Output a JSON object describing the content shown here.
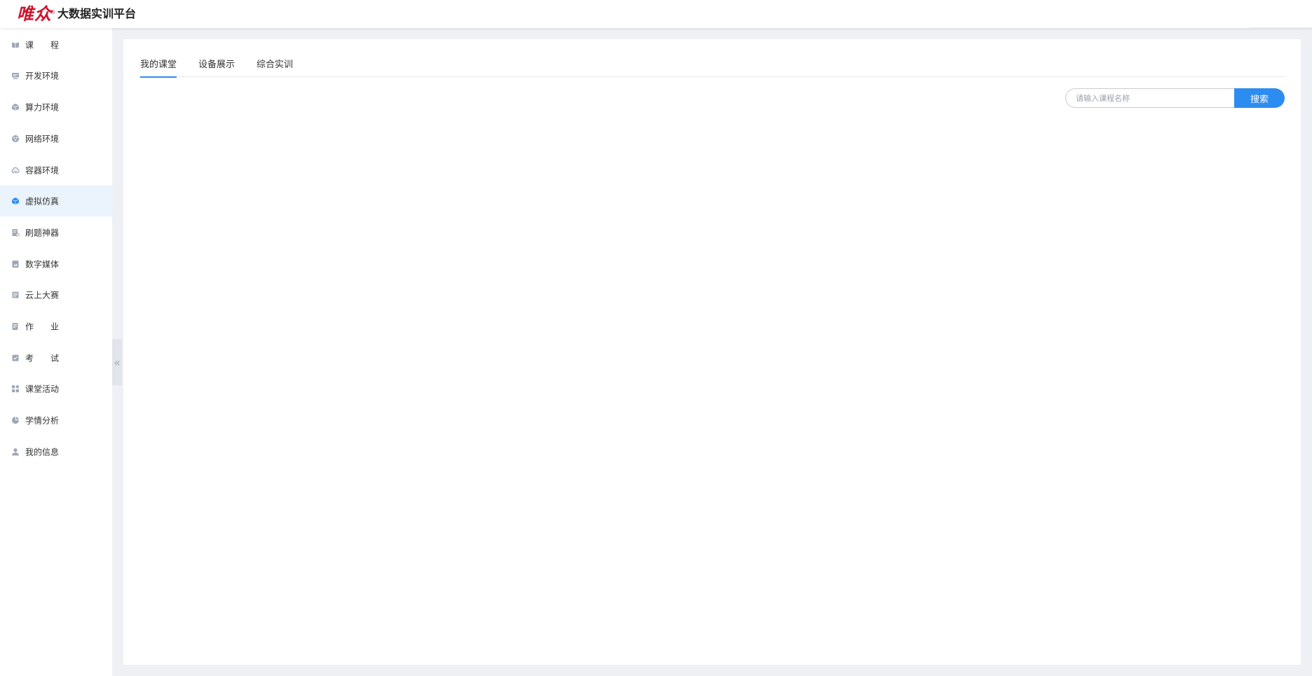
{
  "header": {
    "logo_mark": "唯众",
    "logo_registered": "®",
    "title": "大数据实训平台"
  },
  "sidebar": {
    "items": [
      {
        "label": "课　　程",
        "icon": "book-icon",
        "active": false
      },
      {
        "label": "开发环境",
        "icon": "monitor-icon",
        "active": false
      },
      {
        "label": "算力环境",
        "icon": "cube-icon",
        "active": false
      },
      {
        "label": "网络环境",
        "icon": "network-icon",
        "active": false
      },
      {
        "label": "容器环境",
        "icon": "cloud-icon",
        "active": false
      },
      {
        "label": "虚拟仿真",
        "icon": "box-3d-icon",
        "active": true
      },
      {
        "label": "刷题神器",
        "icon": "quiz-icon",
        "active": false
      },
      {
        "label": "数字媒体",
        "icon": "media-icon",
        "active": false
      },
      {
        "label": "云上大赛",
        "icon": "contest-icon",
        "active": false
      },
      {
        "label": "作　　业",
        "icon": "homework-icon",
        "active": false
      },
      {
        "label": "考　　试",
        "icon": "exam-icon",
        "active": false
      },
      {
        "label": "课堂活动",
        "icon": "grid-icon",
        "active": false
      },
      {
        "label": "学情分析",
        "icon": "pie-chart-icon",
        "active": false
      },
      {
        "label": "我的信息",
        "icon": "user-icon",
        "active": false
      }
    ],
    "collapse_glyph": "«"
  },
  "main": {
    "tabs": [
      {
        "label": "我的课堂",
        "active": true
      },
      {
        "label": "设备展示",
        "active": false
      },
      {
        "label": "综合实训",
        "active": false
      }
    ],
    "search": {
      "placeholder": "请输入课程名称",
      "value": "",
      "button_label": "搜索"
    }
  },
  "colors": {
    "accent": "#2d8cf0",
    "brand_red": "#d0122b",
    "active_bg": "#ebf4fd",
    "page_bg": "#eef0f4",
    "icon_gray": "#9ea7b5"
  }
}
